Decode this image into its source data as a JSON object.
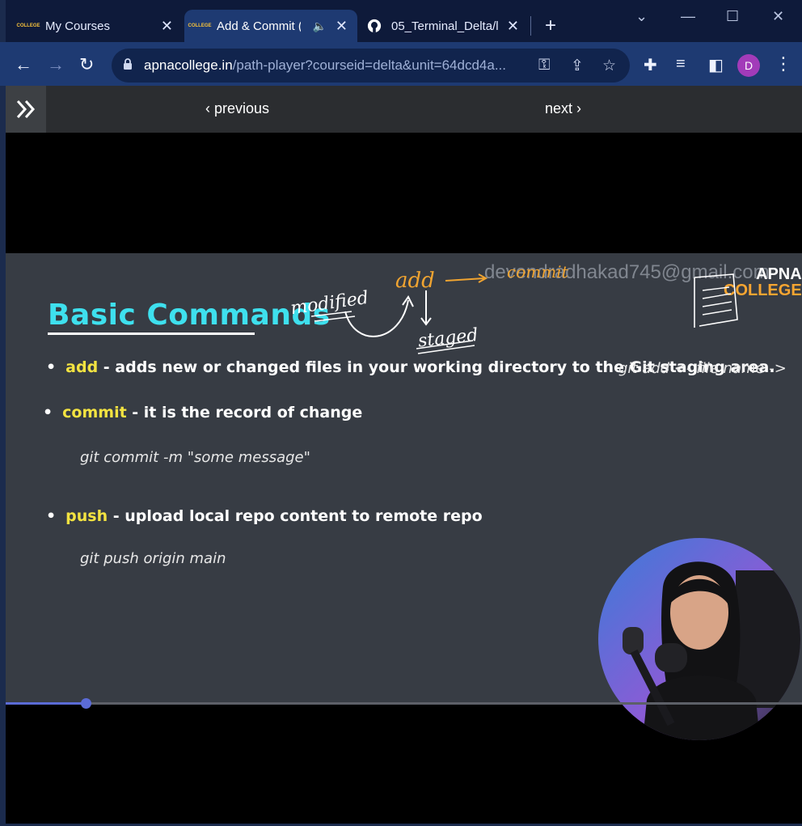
{
  "browser": {
    "tabs": [
      {
        "title": "My Courses",
        "favicon": "apna-college-favicon",
        "active": false
      },
      {
        "title": "Add & Commit (",
        "favicon": "apna-college-favicon",
        "active": true,
        "audio": true
      },
      {
        "title": "05_Terminal_Delta/l_",
        "favicon": "github-icon",
        "active": false
      }
    ],
    "url_host": "apnacollege.in",
    "url_path": "/path-player?courseid=delta&unit=64dcd4a...",
    "avatar_letter": "D",
    "colors": {
      "frame": "#0e1a3a",
      "toolbar": "#1e3a72",
      "omnibox": "#11244d",
      "avatar": "#a23bb9"
    }
  },
  "player": {
    "previous_label": "previous",
    "next_label": "next",
    "progress": 0.1
  },
  "slide": {
    "title": "Basic Commands",
    "watermark": "devendradhakad745@gmail.com",
    "logo_line1": "APNA",
    "logo_line2": "COLLEGE",
    "bullets": [
      {
        "keyword": "add",
        "text": " - adds new or changed files in your working directory to the Git staging area."
      },
      {
        "keyword": "commit",
        "text": " - it is the record of change"
      },
      {
        "keyword": "push",
        "text": " - upload local repo content to remote repo"
      }
    ],
    "code_add": "git add <- file name ->",
    "code_commit": "git commit -m \"some message\"",
    "code_push": "git push origin main",
    "annotations": {
      "modified": "modified",
      "add": "add",
      "commit": "commit",
      "staged": "staged"
    },
    "colors": {
      "title": "#3ee0ee",
      "keyword": "#f3e341",
      "background": "#373c44",
      "annotation_orange": "#f0a431"
    }
  }
}
